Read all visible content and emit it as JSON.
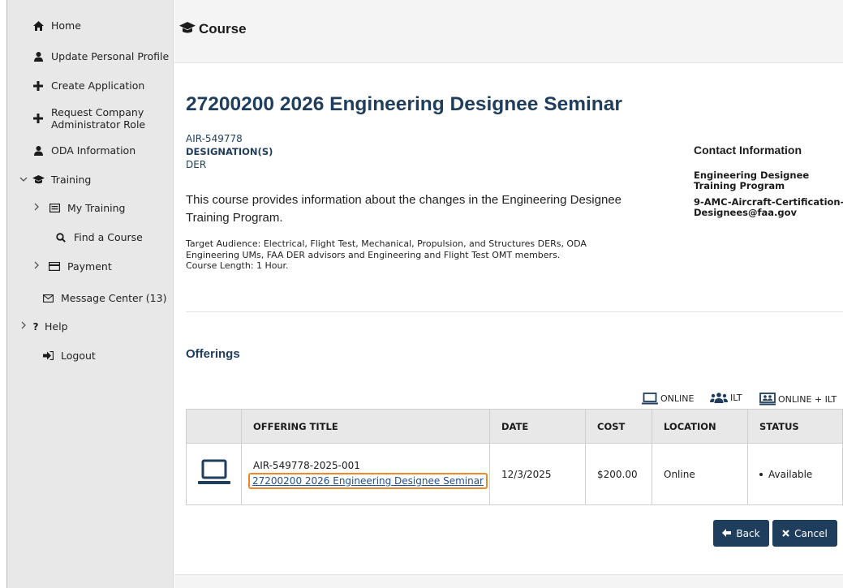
{
  "sidebar": {
    "items": [
      {
        "label": "Home",
        "icon": "home-icon"
      },
      {
        "label": "Update Personal Profile",
        "icon": "user-icon"
      },
      {
        "label": "Create Application",
        "icon": "plus-icon"
      },
      {
        "label": "Request Company\nAdministrator Role",
        "icon": "plus-icon"
      },
      {
        "label": "ODA Information",
        "icon": "user-icon"
      },
      {
        "label": "Training",
        "icon": "graduation-cap-icon"
      },
      {
        "label": "My Training",
        "icon": "list-icon"
      },
      {
        "label": "Find a Course",
        "icon": "search-icon"
      },
      {
        "label": "Payment",
        "icon": "credit-card-icon"
      },
      {
        "label": "Message Center (13)",
        "icon": "envelope-icon"
      },
      {
        "label": "Help",
        "icon": "question-icon"
      },
      {
        "label": "Logout",
        "icon": "logout-icon"
      }
    ]
  },
  "header": {
    "title": "Course"
  },
  "course": {
    "title": "27200200 2026 Engineering Designee Seminar",
    "code": "AIR-549778",
    "designation_heading": "DESIGNATION(S)",
    "designation_value": "DER",
    "description": "This course provides information about the changes in the Engineering Designee Training Program.",
    "target_audience": "Target Audience: Electrical, Flight Test, Mechanical, Propulsion, and Structures DERs, ODA Engineering UMs, FAA DER advisors and Engineering and Flight Test OMT members.",
    "course_length": "Course Length: 1 Hour."
  },
  "contact": {
    "heading": "Contact Information",
    "name": "Engineering Designee Training Program",
    "email": "9-AMC-Aircraft-Certification-Designees@faa.gov"
  },
  "offerings": {
    "heading": "Offerings",
    "legend": {
      "online": "ONLINE",
      "ilt": "ILT",
      "online_ilt": "ONLINE + ILT"
    },
    "columns": [
      "",
      "OFFERING TITLE",
      "DATE",
      "COST",
      "LOCATION",
      "STATUS"
    ],
    "rows": [
      {
        "type_icon": "laptop-icon",
        "code": "AIR-549778-2025-001",
        "title": "27200200 2026 Engineering Designee Seminar",
        "date": "12/3/2025",
        "cost": "$200.00",
        "location": "Online",
        "status": "Available"
      }
    ]
  },
  "buttons": {
    "back": "Back",
    "cancel": "Cancel"
  },
  "colors": {
    "primary": "#1f3d5c",
    "highlight": "#ea8a2a",
    "link": "#1f4f8c"
  }
}
